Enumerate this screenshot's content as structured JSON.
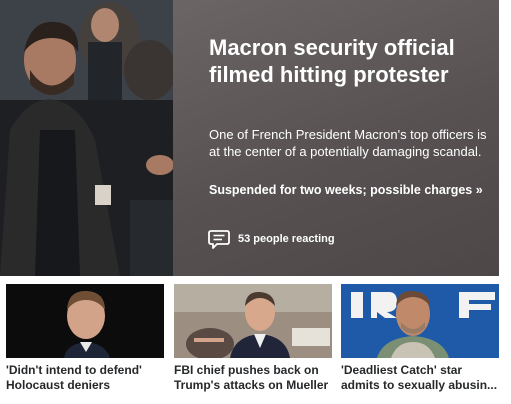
{
  "hero": {
    "title": "Macron security official filmed hitting protester",
    "summary": "One of French President Macron's top officers is at the center of a potentially damaging scandal.",
    "link_text": "Suspended for two weeks; possible charges »",
    "reactions": "53 people reacting",
    "reaction_icon": "comment-bubble-icon",
    "panel_color": "#5e5859"
  },
  "cards": [
    {
      "line1": "'Didn't intend to defend'",
      "line2": "Holocaust deniers"
    },
    {
      "line1": "FBI chief pushes back on",
      "line2": "Trump's attacks on Mueller"
    },
    {
      "line1": "'Deadliest Catch' star",
      "line2": "admits to sexually abusin..."
    }
  ]
}
